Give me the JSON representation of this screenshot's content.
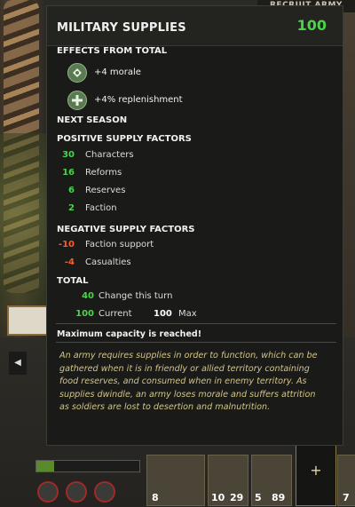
{
  "background": {
    "top_label": "RECRUIT ARMY",
    "bottom_cards": [
      {
        "num_a": "8"
      },
      {
        "num_a": "10",
        "num_b": "29"
      },
      {
        "num_a": "5",
        "num_b": "89"
      },
      {
        "num_a": "7"
      }
    ]
  },
  "tooltip": {
    "title": "MILITARY SUPPLIES",
    "value": "100",
    "effects_header": "EFFECTS FROM TOTAL",
    "effects": [
      {
        "icon": "morale-icon",
        "text": "+4 morale"
      },
      {
        "icon": "replenishment-icon",
        "text": "+4% replenishment"
      }
    ],
    "next_season": "NEXT SEASON",
    "positive_header": "POSITIVE SUPPLY FACTORS",
    "positive": [
      {
        "value": "30",
        "label": "Characters"
      },
      {
        "value": "16",
        "label": "Reforms"
      },
      {
        "value": "6",
        "label": "Reserves"
      },
      {
        "value": "2",
        "label": "Faction"
      }
    ],
    "negative_header": "NEGATIVE SUPPLY FACTORS",
    "negative": [
      {
        "value": "-10",
        "label": "Faction support"
      },
      {
        "value": "-4",
        "label": "Casualties"
      }
    ],
    "total_header": "TOTAL",
    "total_change": {
      "value": "40",
      "label": "Change this turn"
    },
    "current": {
      "value": "100",
      "label": "Current"
    },
    "max": {
      "value": "100",
      "label": "Max"
    },
    "capacity_note": "Maximum capacity is reached!",
    "description": "An army requires supplies in order to function, which can be gathered when it is in friendly or allied territory containing food reserves, and consumed when in enemy territory. As supplies dwindle, an army loses morale and suffers attrition as soldiers are lost to desertion and malnutrition."
  },
  "colors": {
    "positive": "#4bd34b",
    "negative": "#ff5a2b",
    "description_text": "#d1c487"
  }
}
